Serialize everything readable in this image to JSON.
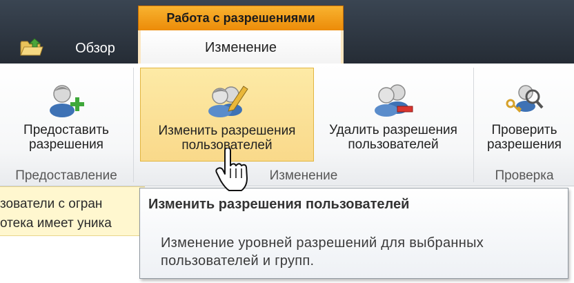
{
  "tabs": {
    "contextual_group_label": "Работа с разрешениями",
    "browse_label": "Обзор",
    "active_tab_label": "Изменение"
  },
  "ribbon": {
    "groups": [
      {
        "label": "Предоставление",
        "buttons": [
          {
            "label_line1": "Предоставить",
            "label_line2": "разрешения",
            "icon": "grant-permissions-icon"
          }
        ]
      },
      {
        "label": "Изменение",
        "buttons": [
          {
            "label_line1": "Изменить разрешения",
            "label_line2": "пользователей",
            "icon": "edit-user-permissions-icon",
            "state": "hover"
          },
          {
            "label_line1": "Удалить разрешения",
            "label_line2": "пользователей",
            "icon": "remove-user-permissions-icon"
          }
        ]
      },
      {
        "label": "Проверка",
        "buttons": [
          {
            "label_line1": "Проверить",
            "label_line2": "разрешения",
            "icon": "check-permissions-icon"
          }
        ]
      }
    ]
  },
  "content": {
    "line1": "зователи с огран",
    "line2": "отека имеет уника"
  },
  "tooltip": {
    "title": "Изменить разрешения пользователей",
    "body_line1": "Изменение уровней разрешений для выбранных",
    "body_line2": "пользователей и групп."
  },
  "colors": {
    "contextual_orange": "#f0a020",
    "hover_yellow": "#fbe3a0",
    "dark_bar": "#2b323b"
  }
}
